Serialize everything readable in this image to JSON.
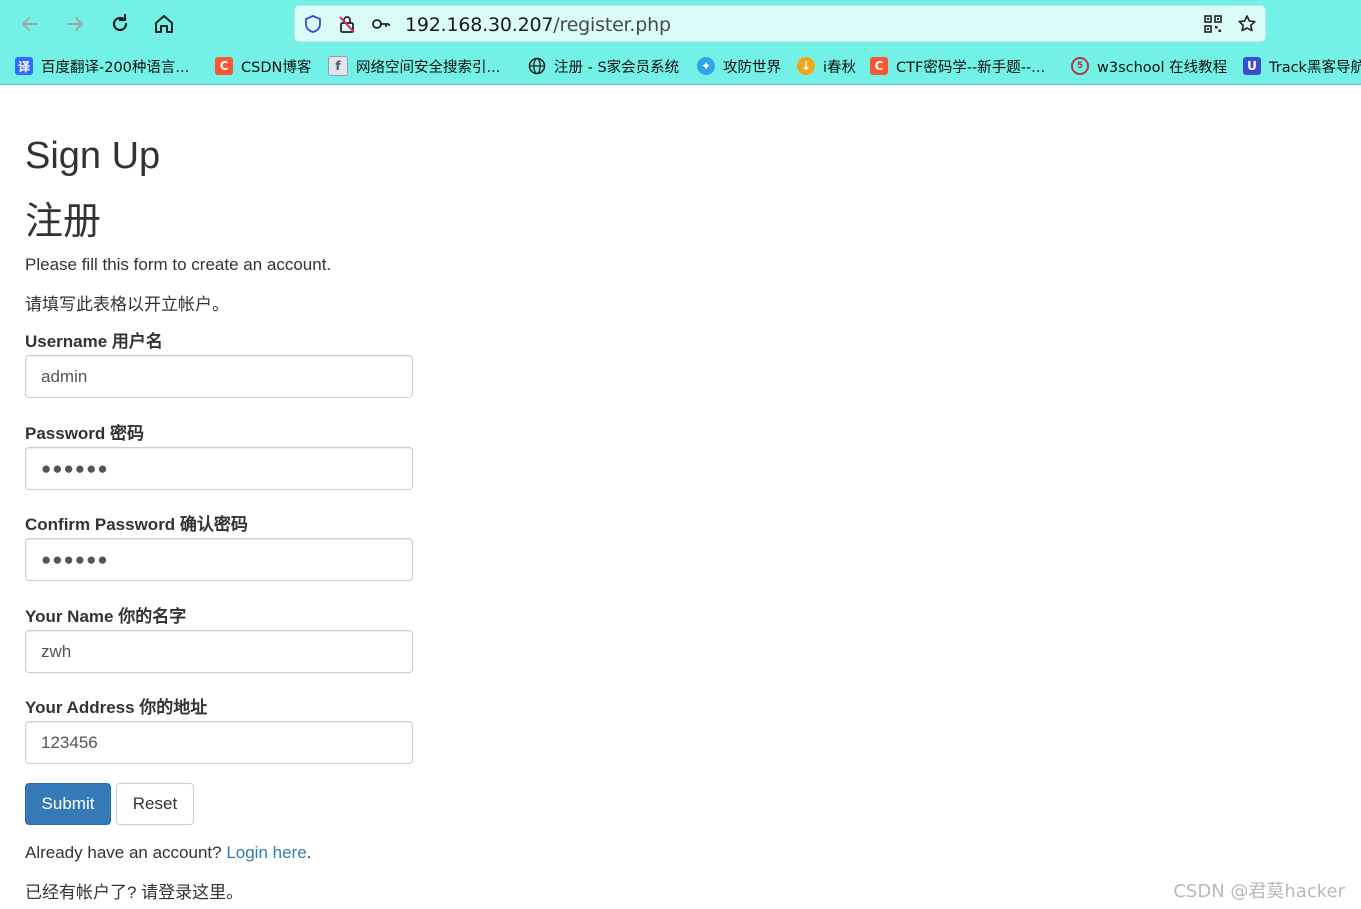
{
  "browser": {
    "url_host": "192.168.30.207",
    "url_path": "/register.php",
    "bookmarks": [
      {
        "label": "百度翻译-200种语言...",
        "icon": "translate-icon",
        "icon_text": "译",
        "color": "#2f6bff"
      },
      {
        "label": "CSDN博客",
        "icon": "csdn-icon",
        "icon_text": "C",
        "color": "#fc5531"
      },
      {
        "label": "网络空间安全搜索引...",
        "icon": "fofa-icon",
        "icon_text": "f",
        "color": "#8aa0b0"
      },
      {
        "label": "注册 - S家会员系统",
        "icon": "globe-icon",
        "icon_text": "",
        "color": "#222222"
      },
      {
        "label": "攻防世界",
        "icon": "adworld-icon",
        "icon_text": "",
        "color": "#2fa4e7"
      },
      {
        "label": "i春秋",
        "icon": "ichunqiu-icon",
        "icon_text": "",
        "color": "#f2a51a"
      },
      {
        "label": "CTF密码学--新手题--...",
        "icon": "csdn-icon",
        "icon_text": "C",
        "color": "#fc5531"
      },
      {
        "label": "w3school 在线教程",
        "icon": "w3school-icon",
        "icon_text": "",
        "color": "#b03a3a"
      },
      {
        "label": "Track黑客导航",
        "icon": "track-icon",
        "icon_text": "",
        "color": "#3b4ccf"
      }
    ]
  },
  "page": {
    "title_en": "Sign Up",
    "title_zh": "注册",
    "intro_en": "Please fill this form to create an account.",
    "intro_zh": "请填写此表格以开立帐户。",
    "fields": {
      "username": {
        "label": "Username 用户名",
        "value": "admin"
      },
      "password": {
        "label": "Password 密码",
        "value": "●●●●●●"
      },
      "confirm": {
        "label": "Confirm Password 确认密码",
        "value": "●●●●●●"
      },
      "name": {
        "label": "Your Name 你的名字",
        "value": "zwh"
      },
      "address": {
        "label": "Your Address 你的地址",
        "value": "123456"
      }
    },
    "submit_label": "Submit",
    "reset_label": "Reset",
    "have_account": "Already have an account? ",
    "login_link": "Login here",
    "period": ".",
    "footer_zh": "已经有帐户了? 请登录这里。"
  },
  "watermark": "CSDN @君莫hacker"
}
